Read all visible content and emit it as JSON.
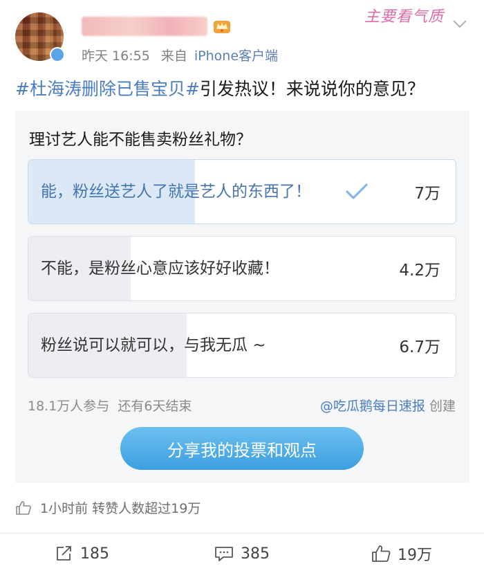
{
  "header": {
    "username": "吃瓜鹅每日速报",
    "timestamp": "昨天 16:55",
    "source_prefix": "来自",
    "device": "iPhone客户端",
    "watermark": "主要看气质"
  },
  "post": {
    "topic": "#杜海涛删除已售宝贝#",
    "text": "引发热议！来说说你的意见？"
  },
  "poll": {
    "question": "理讨艺人能不能售卖粉丝礼物？",
    "options": [
      {
        "label": "能，粉丝送艺人了就是艺人的东西了！",
        "count": "7万",
        "selected": true,
        "share": 0.39
      },
      {
        "label": "不能，是粉丝心意应该好好收藏！",
        "count": "4.2万",
        "selected": false,
        "share": 0.24
      },
      {
        "label": "粉丝说可以就可以，与我无瓜 ~",
        "count": "6.7万",
        "selected": false,
        "share": 0.37
      }
    ],
    "participants": "18.1万人参与",
    "remaining": "还有6天结束",
    "creator": "@吃瓜鹅每日速报",
    "creator_suffix": "创建",
    "share_button": "分享我的投票和观点"
  },
  "activity": {
    "text": "1小时前 转赞人数超过19万"
  },
  "actions": {
    "repost": "185",
    "comment": "385",
    "like": "19万"
  },
  "colors": {
    "topic": "#4a7cc0",
    "selected_fill": "#dbe9f6",
    "button": "#3d9ee0"
  }
}
